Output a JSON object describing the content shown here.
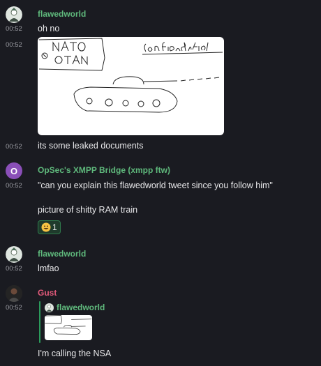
{
  "colors": {
    "background": "#1a1b21",
    "username_green": "#5fb97c",
    "username_pink": "#e05a7a",
    "timestamp": "#9b9ca3",
    "reaction_border": "#2f7a4c"
  },
  "messages": [
    {
      "author": "flawedworld",
      "time": "00:52",
      "text": "oh no"
    },
    {
      "time": "00:52",
      "attachment": {
        "type": "drawing-image",
        "drawn_text": [
          "NATO",
          "OTAN",
          "confidential"
        ]
      }
    },
    {
      "time": "00:52",
      "text": "its some leaked documents"
    },
    {
      "author": "OpSec's XMPP Bridge (xmpp ftw)",
      "avatar_letter": "O",
      "time": "00:52",
      "text": "\"can you explain this flawedworld tweet since you follow him\""
    },
    {
      "text": "picture of shitty RAM train",
      "reaction": {
        "icon": "grinning-emoji-icon",
        "count": "1"
      }
    },
    {
      "author": "flawedworld",
      "time": "00:52",
      "text": "lmfao"
    },
    {
      "author": "Gust",
      "time": "00:52",
      "reply_to": "flawedworld",
      "text": "I'm calling the NSA"
    }
  ]
}
